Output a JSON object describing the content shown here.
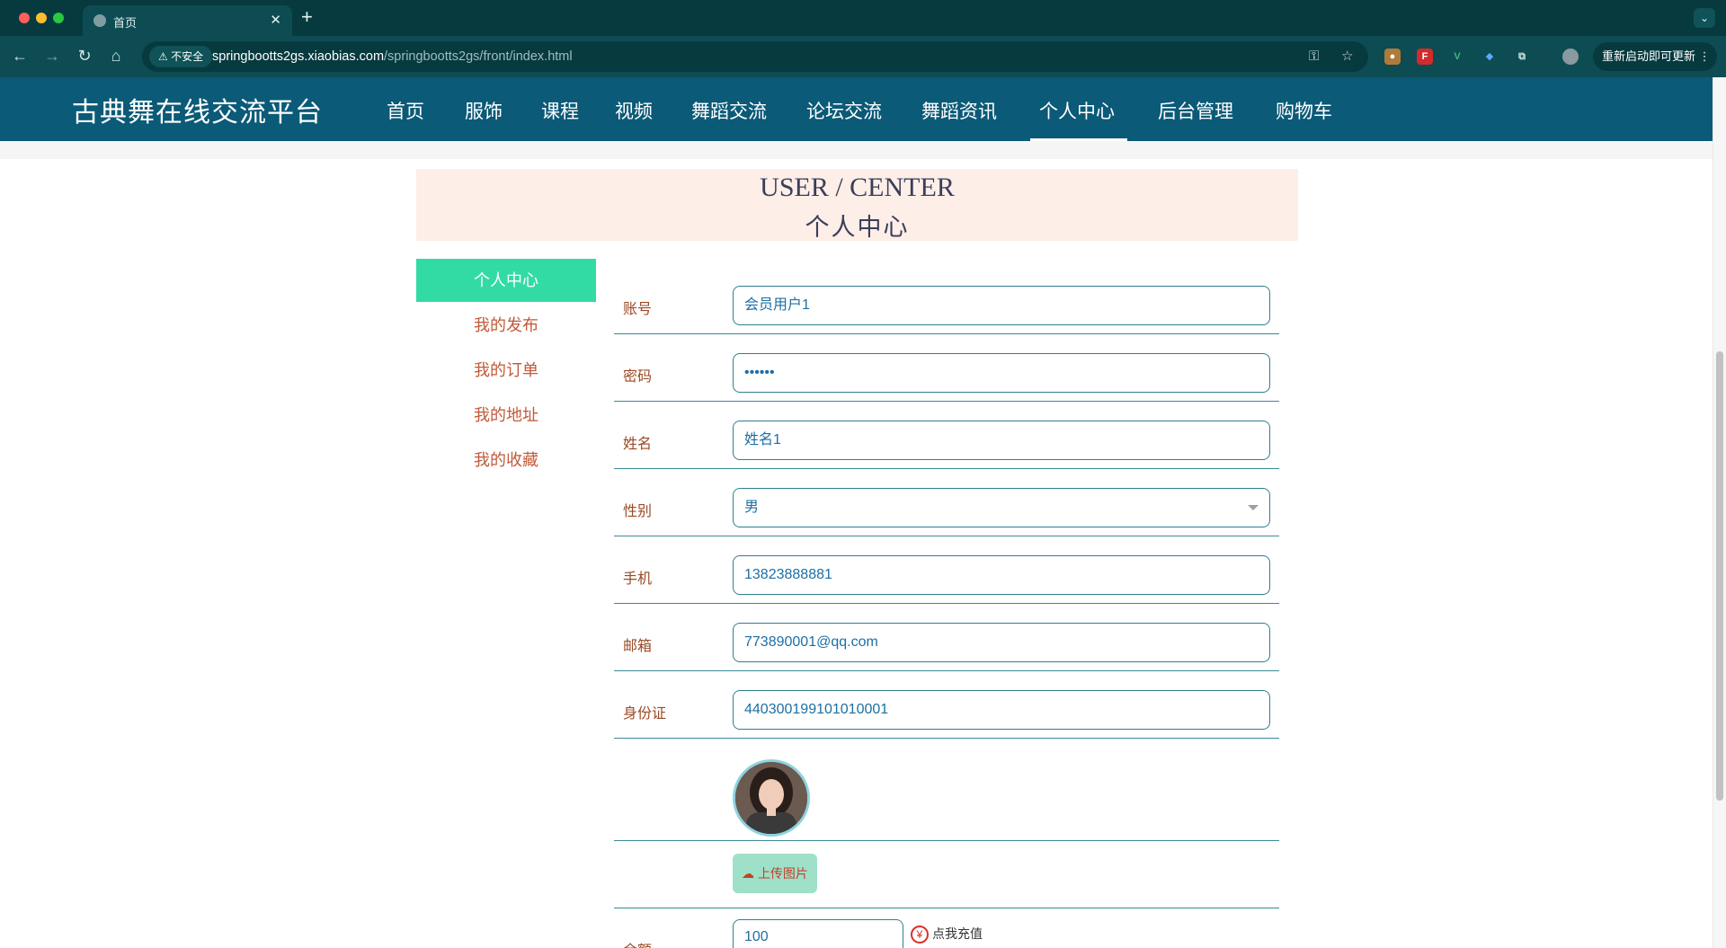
{
  "browser": {
    "tab_title": "首页",
    "tab_close": "✕",
    "new_tab": "+",
    "tab_menu": "⌄",
    "security_label": "⚠ 不安全",
    "url_host": "springbootts2gs.xiaobias.com",
    "url_path": "/springbootts2gs/front/index.html",
    "update_button": "重新启动即可更新 ⋮"
  },
  "site": {
    "logo": "古典舞在线交流平台",
    "nav": [
      "首页",
      "服饰",
      "课程",
      "视频",
      "舞蹈交流",
      "论坛交流",
      "舞蹈资讯",
      "个人中心",
      "后台管理",
      "购物车"
    ],
    "active_nav": "个人中心"
  },
  "banner": {
    "en": "USER / CENTER",
    "cn": "个人中心"
  },
  "side_menu": [
    "个人中心",
    "我的发布",
    "我的订单",
    "我的地址",
    "我的收藏"
  ],
  "form": {
    "account": {
      "label": "账号",
      "value": "会员用户1"
    },
    "password": {
      "label": "密码",
      "value": "••••••"
    },
    "name": {
      "label": "姓名",
      "value": "姓名1"
    },
    "gender": {
      "label": "性别",
      "value": "男"
    },
    "phone": {
      "label": "手机",
      "value": "13823888881"
    },
    "email": {
      "label": "邮箱",
      "value": "773890001@qq.com"
    },
    "idcard": {
      "label": "身份证",
      "value": "440300199101010001"
    },
    "upload_button": "上传图片",
    "balance": {
      "label": "余额",
      "value": "100"
    },
    "recharge": "点我充值"
  }
}
